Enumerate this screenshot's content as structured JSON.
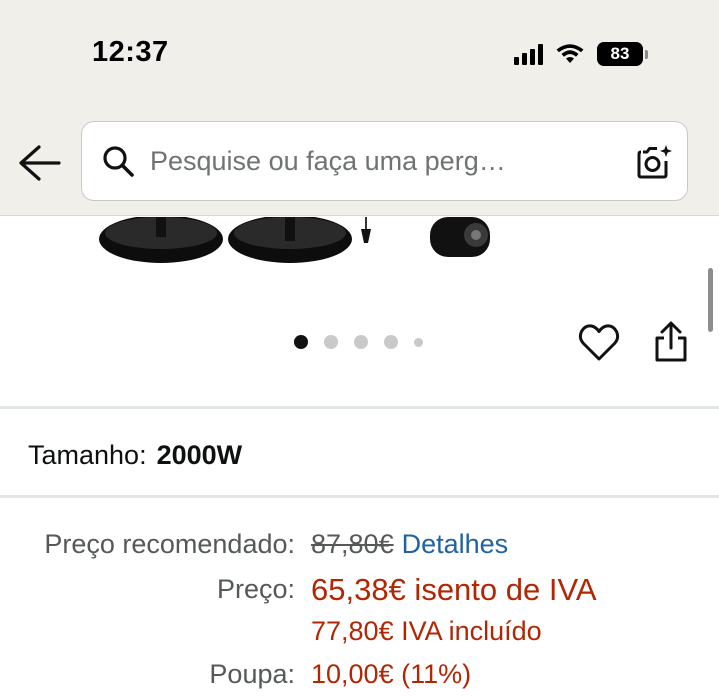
{
  "status_bar": {
    "time": "12:37",
    "battery": "83"
  },
  "header": {
    "search_placeholder": "Pesquise ou faça uma perg…"
  },
  "gallery": {
    "dot_count": 5,
    "active_index": 0
  },
  "size": {
    "label": "Tamanho:",
    "value": "2000W"
  },
  "pricing": {
    "recommended_label": "Preço recomendado:",
    "recommended_value": "87,80€",
    "details_link": "Detalhes",
    "price_label": "Preço:",
    "price_value": "65,38€ isento de IVA",
    "price_with_vat": "77,80€ IVA incluído",
    "savings_label": "Poupa:",
    "savings_value": "10,00€ (11%)"
  },
  "colors": {
    "price_red": "#b12704",
    "link_blue": "#2162a1",
    "header_bg": "#f0efea"
  }
}
